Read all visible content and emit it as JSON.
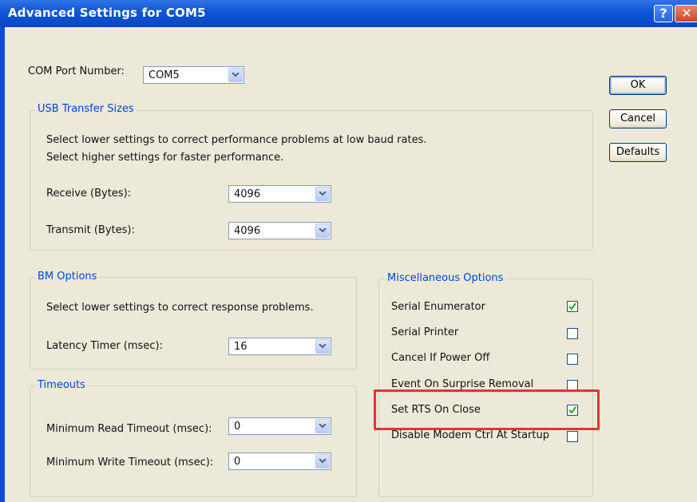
{
  "window": {
    "title": "Advanced Settings for COM5",
    "help_glyph": "?",
    "close_glyph": "✕"
  },
  "com_port": {
    "label": "COM Port Number:",
    "value": "COM5"
  },
  "buttons": {
    "ok": "OK",
    "cancel": "Cancel",
    "defaults": "Defaults"
  },
  "usb": {
    "title": "USB Transfer Sizes",
    "line1": "Select lower settings to correct performance problems at low baud rates.",
    "line2": "Select higher settings for faster performance.",
    "receive_label": "Receive (Bytes):",
    "receive_value": "4096",
    "transmit_label": "Transmit (Bytes):",
    "transmit_value": "4096"
  },
  "bm": {
    "title": "BM Options",
    "line1": "Select lower settings to correct response problems.",
    "latency_label": "Latency Timer (msec):",
    "latency_value": "16"
  },
  "timeouts": {
    "title": "Timeouts",
    "read_label": "Minimum Read Timeout (msec):",
    "read_value": "0",
    "write_label": "Minimum Write Timeout (msec):",
    "write_value": "0"
  },
  "misc": {
    "title": "Miscellaneous Options",
    "options": [
      {
        "label": "Serial Enumerator",
        "checked": true
      },
      {
        "label": "Serial Printer",
        "checked": false
      },
      {
        "label": "Cancel If Power Off",
        "checked": false
      },
      {
        "label": "Event On Surprise Removal",
        "checked": false
      },
      {
        "label": "Set RTS On Close",
        "checked": true
      },
      {
        "label": "Disable Modem Ctrl At Startup",
        "checked": false
      }
    ]
  },
  "colors": {
    "title_bar": "#0b4fd0",
    "dialog_face": "#ece9d8",
    "group_label": "#0046d5",
    "highlight": "#e53333",
    "check": "#21a121"
  }
}
